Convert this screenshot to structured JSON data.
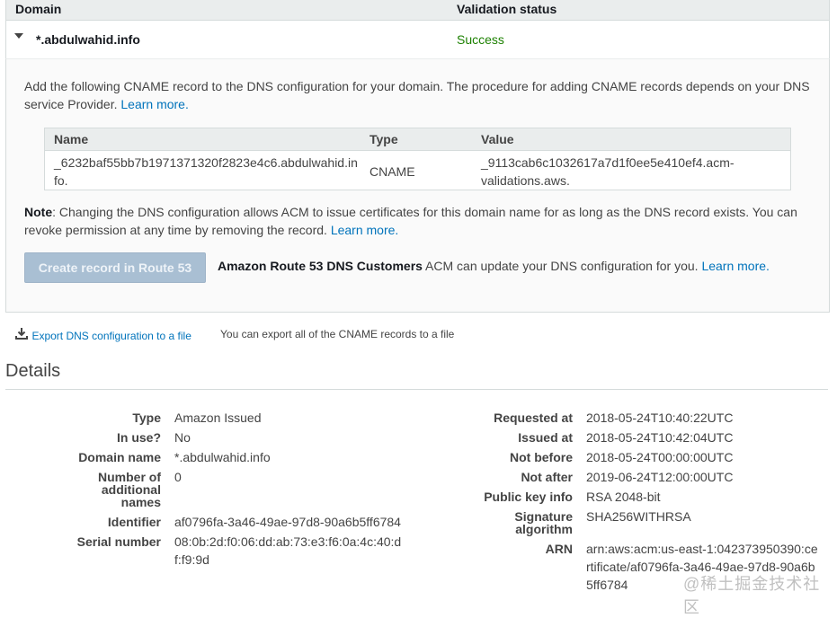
{
  "table": {
    "col_domain": "Domain",
    "col_status": "Validation status",
    "domain": "*.abdulwahid.info",
    "status": "Success"
  },
  "panel": {
    "instructions": "Add the following CNAME record to the DNS configuration for your domain. The procedure for adding CNAME records depends on your DNS service Provider.",
    "learn_more_1": "Learn more.",
    "cname": {
      "col_name": "Name",
      "col_type": "Type",
      "col_value": "Value",
      "name_line1": "_6232baf55bb7b1971371320f2823e4c6.abdulwahid.in",
      "name_line2": "fo.",
      "type": "CNAME",
      "value_line1": "_9113cab6c1032617a7d1f0ee5e410ef4.acm-",
      "value_line2": "validations.aws."
    },
    "note_label": "Note",
    "note_text": ": Changing the DNS configuration allows ACM to issue certificates for this domain name for as long as the DNS record exists. You can revoke permission at any time by removing the record.",
    "learn_more_2": "Learn more.",
    "route53_button": "Create record in Route 53",
    "route53_bold": "Amazon Route 53 DNS Customers",
    "route53_text": " ACM can update your DNS configuration for you.",
    "learn_more_3": "Learn more."
  },
  "export": {
    "link": "Export DNS configuration to a file",
    "hint": "You can export all of the CNAME records to a file"
  },
  "details": {
    "title": "Details",
    "left": [
      {
        "label": "Type",
        "value": "Amazon Issued"
      },
      {
        "label": "In use?",
        "value": "No"
      },
      {
        "label": "Domain name",
        "value": "*.abdulwahid.info"
      },
      {
        "label": "Number of additional names",
        "value": "0"
      },
      {
        "label": "Identifier",
        "value": "af0796fa-3a46-49ae-97d8-90a6b5ff6784"
      },
      {
        "label": "Serial number",
        "value": "08:0b:2d:f0:06:dd:ab:73:e3:f6:0a:4c:40:df:f9:9d"
      }
    ],
    "right": [
      {
        "label": "Requested at",
        "value": "2018-05-24T10:40:22UTC"
      },
      {
        "label": "Issued at",
        "value": "2018-05-24T10:42:04UTC"
      },
      {
        "label": "Not before",
        "value": "2018-05-24T00:00:00UTC"
      },
      {
        "label": "Not after",
        "value": "2019-06-24T12:00:00UTC"
      },
      {
        "label": "Public key info",
        "value": "RSA 2048-bit"
      },
      {
        "label": "Signature algorithm",
        "value": "SHA256WITHRSA"
      },
      {
        "label": "ARN",
        "value": "arn:aws:acm:us-east-1:042373950390:certificate/af0796fa-3a46-49ae-97d8-90a6b5ff6784"
      }
    ]
  },
  "watermark": "@稀土掘金技术社区",
  "colors": {
    "link": "#0073bb",
    "success": "#1d8102",
    "button_disabled": "#a9bfd3"
  }
}
